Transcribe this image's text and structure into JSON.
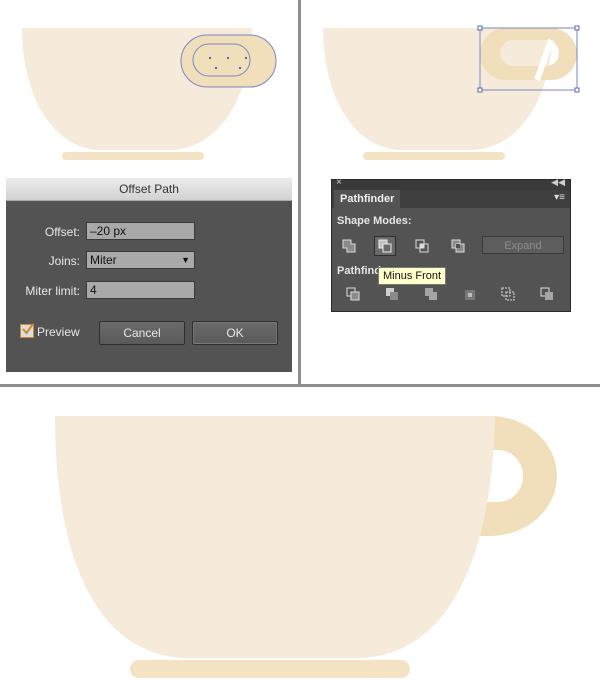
{
  "colors": {
    "cup": "#f6ebda",
    "handle": "#f0dfba",
    "saucer": "#f4e3c4",
    "panel": "#535353"
  },
  "offset_dialog": {
    "title": "Offset Path",
    "offset_label": "Offset:",
    "offset_value": "–20 px",
    "joins_label": "Joins:",
    "joins_value": "Miter",
    "miter_label": "Miter limit:",
    "miter_value": "4",
    "preview_label": "Preview",
    "preview_checked": true,
    "cancel_label": "Cancel",
    "ok_label": "OK"
  },
  "pathfinder": {
    "tab_label": "Pathfinder",
    "shape_modes_label": "Shape Modes:",
    "pathfinders_label": "Pathfind",
    "expand_label": "Expand",
    "tooltip": "Minus Front",
    "shape_mode_icons": [
      "unite-icon",
      "minus-front-icon",
      "intersect-icon",
      "exclude-icon"
    ],
    "pathfinder_icons": [
      "divide-icon",
      "trim-icon",
      "merge-icon",
      "crop-icon",
      "outline-icon",
      "minus-back-icon"
    ]
  }
}
